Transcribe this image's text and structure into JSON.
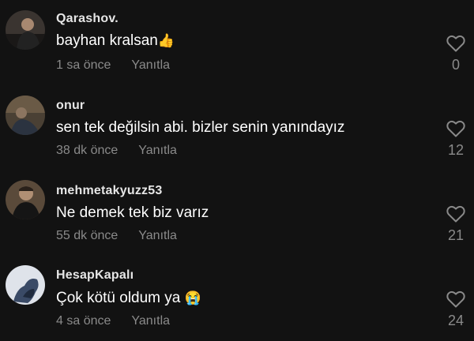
{
  "comments": [
    {
      "username": "Qarashov.",
      "text": "bayhan kralsan",
      "emoji": "👍",
      "time": "1 sa önce",
      "reply": "Yanıtla",
      "likes": "0"
    },
    {
      "username": "onur",
      "text": "sen tek değilsin abi. bizler senin yanındayız",
      "emoji": "",
      "time": "38 dk önce",
      "reply": "Yanıtla",
      "likes": "12"
    },
    {
      "username": "mehmetakyuzz53",
      "text": "Ne demek tek biz varız",
      "emoji": "",
      "time": "55 dk önce",
      "reply": "Yanıtla",
      "likes": "21"
    },
    {
      "username": "HesapKapalı",
      "text": "Çok kötü oldum ya",
      "emoji": "😭",
      "time": "4 sa önce",
      "reply": "Yanıtla",
      "likes": "24"
    }
  ],
  "icons": {
    "like": "heart-outline-icon"
  },
  "colors": {
    "background": "#121212",
    "username": "#e6e6e6",
    "secondary": "#8a8a8a"
  }
}
